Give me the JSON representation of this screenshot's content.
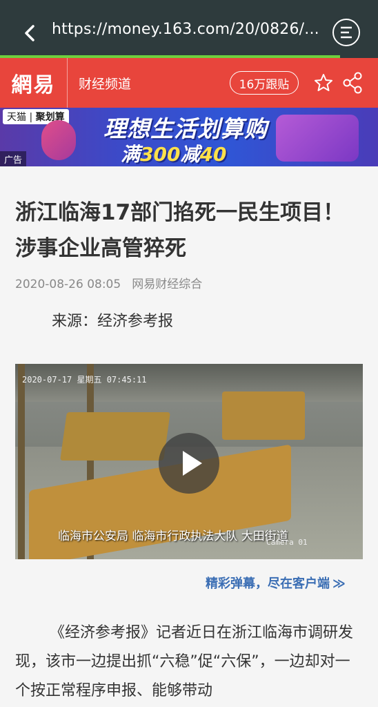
{
  "browser": {
    "url": "https://money.163.com/20/0826/...",
    "load_progress": 0.9
  },
  "site": {
    "logo": "網易",
    "channel": "财经频道",
    "follow_label": "16万跟贴"
  },
  "ad": {
    "platform": "天猫",
    "platform_sub": "聚划算",
    "headline": "理想生活划算购",
    "promo_prefix": "满",
    "promo_num1": "300",
    "promo_mid": "减",
    "promo_num2": "40",
    "ad_label": "广告"
  },
  "article": {
    "title": "浙江临海17部门掐死一民生项目！涉事企业高管猝死",
    "date": "2020-08-26 08:05",
    "source_name": "网易财经综合",
    "source_line": "来源：经济参考报",
    "body": "《经济参考报》记者近日在浙江临海市调研发现，该市一边提出抓“六稳”促“六保”，一边却对一个按正常程序申报、能够带动"
  },
  "video": {
    "timestamp": "2020-07-17 星期五 07:45:11",
    "caption": "临海市公安局 临海市行政执法大队 大田街道",
    "camera_label": "Camera 01"
  },
  "danmu": {
    "label": "精彩弹幕，尽在客户端",
    "chevron": "≫"
  }
}
